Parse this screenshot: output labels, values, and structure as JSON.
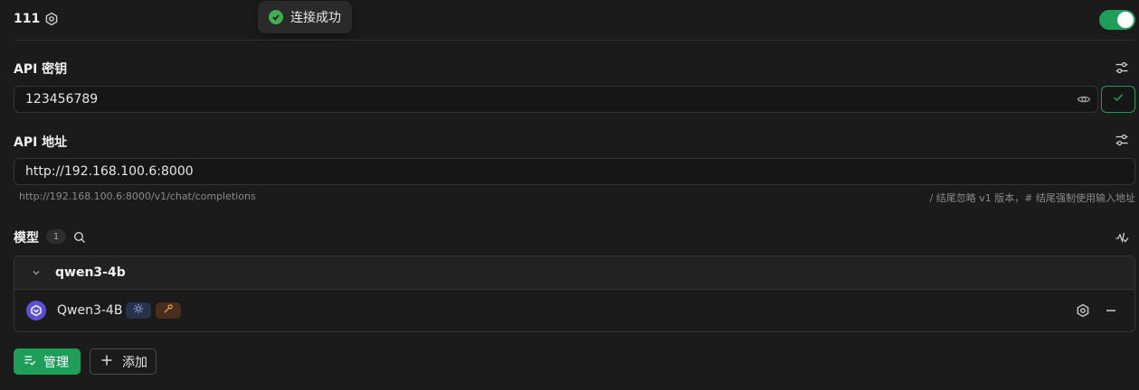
{
  "provider": {
    "name": "111",
    "enabled": true,
    "settings_icon": "gear-icon"
  },
  "toast": {
    "message": "连接成功",
    "icon": "check-circle-icon",
    "color": "#3fae4f"
  },
  "api_key": {
    "label": "API 密钥",
    "value": "123456789",
    "reveal_icon": "eye-icon",
    "check_icon": "check-icon"
  },
  "api_host": {
    "label": "API 地址",
    "value": "http://192.168.100.6:8000",
    "preview": "http://192.168.100.6:8000/v1/chat/completions",
    "hint": "/ 结尾忽略 v1 版本，# 结尾强制使用输入地址"
  },
  "models": {
    "label": "模型",
    "count": "1",
    "groups": [
      {
        "name": "qwen3-4b",
        "expanded": true,
        "items": [
          {
            "name": "Qwen3-4B",
            "tags": [
              "vision",
              "tool"
            ]
          }
        ]
      }
    ]
  },
  "actions": {
    "manage_label": "管理",
    "add_label": "添加"
  },
  "colors": {
    "accent": "#1f9e5a",
    "background": "#1b1b1b"
  }
}
